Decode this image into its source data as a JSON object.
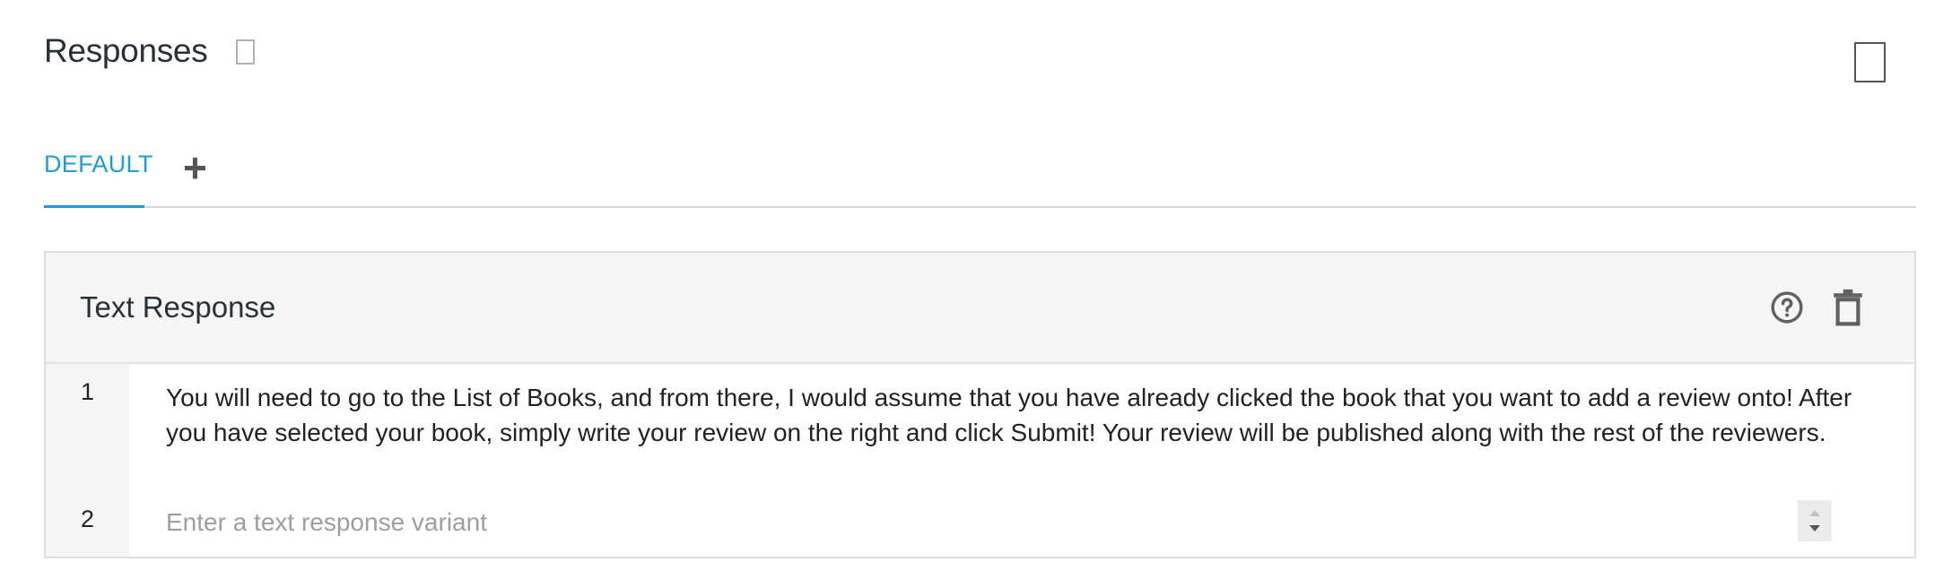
{
  "header": {
    "title": "Responses"
  },
  "tabs": {
    "items": [
      {
        "label": "DEFAULT",
        "active": true
      }
    ],
    "add_symbol": "+"
  },
  "card": {
    "title": "Text Response",
    "icons": [
      "help-icon",
      "delete-icon"
    ],
    "rows": [
      {
        "number": "1",
        "text": "You will need to go to the List of Books, and from there, I would assume that you have already clicked the book that you want to add a review onto! After you have selected your book, simply write your review on the right and click Submit! Your review will be published along with the rest of the reviewers."
      },
      {
        "number": "2",
        "value": "",
        "placeholder": "Enter a text response variant"
      }
    ]
  },
  "colors": {
    "accent": "#1a9ddf",
    "header_bg": "#f5f5f5",
    "border": "#dedede"
  }
}
